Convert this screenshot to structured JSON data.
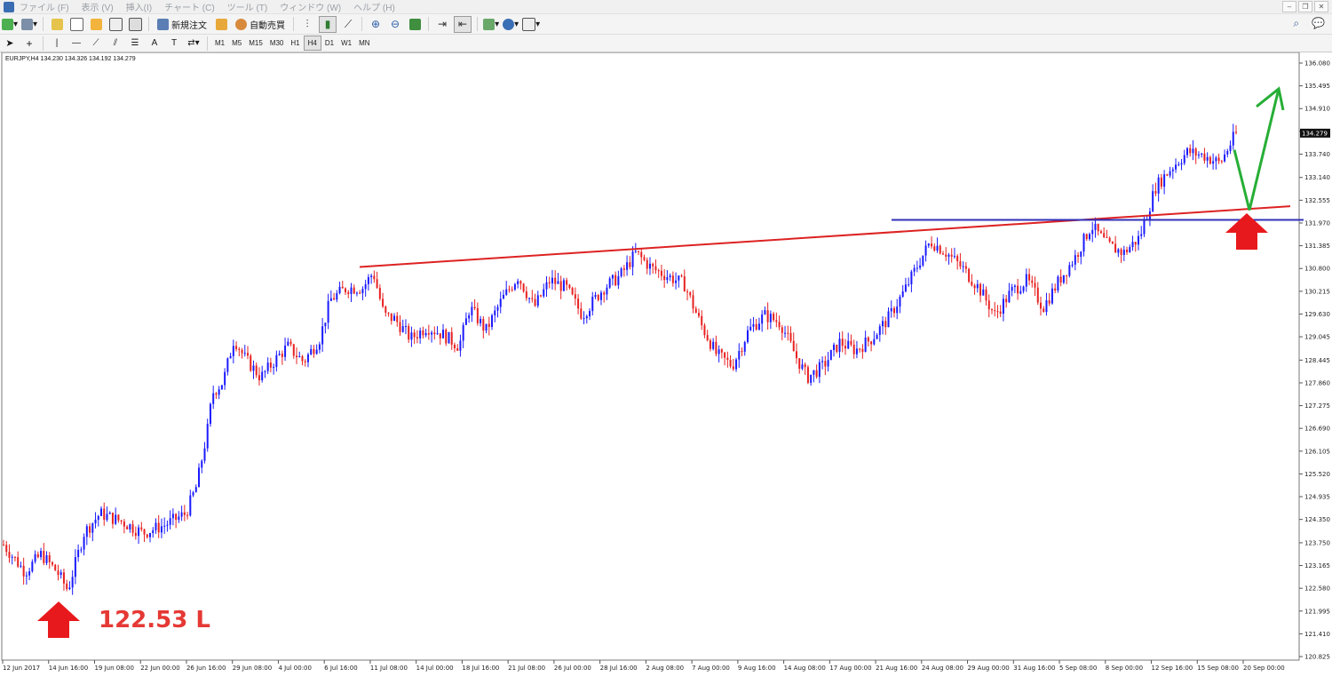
{
  "menu": [
    "ファイル (F)",
    "表示 (V)",
    "挿入(I)",
    "チャート (C)",
    "ツール (T)",
    "ウィンドウ (W)",
    "ヘルプ (H)"
  ],
  "toolbar": {
    "new_order_label": "新規注文",
    "auto_trade_label": "自動売買"
  },
  "timeframes": [
    "M1",
    "M5",
    "M15",
    "M30",
    "H1",
    "H4",
    "D1",
    "W1",
    "MN"
  ],
  "active_timeframe": "H4",
  "chart": {
    "title": "EURJPY,H4  134.230 134.326 134.192 134.279",
    "current_price": "134.279",
    "low_annotation": "122.53 L",
    "colors": {
      "bull": "#1a1aff",
      "bear": "#e82020",
      "trendline": "#dd2222",
      "horizontal_line": "#3030b8",
      "forecast_arrow": "#27ae36",
      "support_arrow": "#e8191d"
    }
  },
  "chart_data": {
    "type": "candlestick",
    "symbol": "EURJPY",
    "timeframe": "H4",
    "ylim": [
      120.825,
      136.08
    ],
    "y_ticks": [
      "136.080",
      "135.495",
      "134.910",
      "134.325",
      "133.740",
      "133.140",
      "132.555",
      "131.970",
      "131.385",
      "130.800",
      "130.215",
      "129.630",
      "129.045",
      "128.445",
      "127.860",
      "127.275",
      "126.690",
      "126.105",
      "125.520",
      "124.935",
      "124.350",
      "123.750",
      "123.165",
      "122.580",
      "121.995",
      "121.410",
      "120.825"
    ],
    "x_ticks": [
      "12 Jun 2017",
      "14 Jun 16:00",
      "19 Jun 08:00",
      "22 Jun 00:00",
      "26 Jun 16:00",
      "29 Jun 08:00",
      "4 Jul 00:00",
      "6 Jul 16:00",
      "11 Jul 08:00",
      "14 Jul 00:00",
      "18 Jul 16:00",
      "21 Jul 08:00",
      "26 Jul 00:00",
      "28 Jul 16:00",
      "2 Aug 08:00",
      "7 Aug 00:00",
      "9 Aug 16:00",
      "14 Aug 08:00",
      "17 Aug 00:00",
      "21 Aug 16:00",
      "24 Aug 08:00",
      "29 Aug 00:00",
      "31 Aug 16:00",
      "5 Sep 08:00",
      "8 Sep 00:00",
      "12 Sep 16:00",
      "15 Sep 08:00",
      "20 Sep 00:00"
    ],
    "price_path": [
      [
        0,
        123.7
      ],
      [
        0.04,
        123.0
      ],
      [
        0.07,
        123.45
      ],
      [
        0.1,
        123.0
      ],
      [
        0.12,
        122.53
      ],
      [
        0.15,
        124.0
      ],
      [
        0.18,
        124.5
      ],
      [
        0.22,
        124.3
      ],
      [
        0.26,
        124.0
      ],
      [
        0.3,
        124.2
      ],
      [
        0.34,
        124.5
      ],
      [
        0.36,
        125.2
      ],
      [
        0.38,
        126.6
      ],
      [
        0.39,
        127.6
      ],
      [
        0.41,
        127.9
      ],
      [
        0.43,
        129.0
      ],
      [
        0.45,
        128.5
      ],
      [
        0.48,
        128.0
      ],
      [
        0.51,
        128.5
      ],
      [
        0.53,
        128.8
      ],
      [
        0.56,
        128.4
      ],
      [
        0.59,
        129.0
      ],
      [
        0.61,
        130.0
      ],
      [
        0.64,
        130.3
      ],
      [
        0.67,
        130.3
      ],
      [
        0.69,
        130.7
      ],
      [
        0.71,
        129.6
      ],
      [
        0.73,
        129.5
      ],
      [
        0.76,
        129.0
      ],
      [
        0.79,
        129.3
      ],
      [
        0.82,
        129.1
      ],
      [
        0.85,
        128.8
      ],
      [
        0.87,
        129.8
      ],
      [
        0.9,
        129.2
      ],
      [
        0.93,
        130.0
      ],
      [
        0.96,
        130.6
      ],
      [
        0.99,
        129.8
      ],
      [
        1.02,
        130.5
      ],
      [
        1.05,
        130.3
      ],
      [
        1.08,
        129.6
      ],
      [
        1.12,
        130.3
      ],
      [
        1.15,
        130.6
      ],
      [
        1.18,
        131.2
      ],
      [
        1.21,
        130.8
      ],
      [
        1.24,
        130.6
      ],
      [
        1.27,
        130.4
      ],
      [
        1.3,
        129.4
      ],
      [
        1.33,
        128.6
      ],
      [
        1.36,
        128.3
      ],
      [
        1.39,
        129.2
      ],
      [
        1.42,
        129.6
      ],
      [
        1.45,
        129.4
      ],
      [
        1.48,
        128.5
      ],
      [
        1.5,
        128.0
      ],
      [
        1.53,
        128.3
      ],
      [
        1.56,
        128.9
      ],
      [
        1.59,
        128.7
      ],
      [
        1.62,
        129.0
      ],
      [
        1.65,
        129.5
      ],
      [
        1.68,
        130.2
      ],
      [
        1.71,
        131.0
      ],
      [
        1.73,
        131.5
      ],
      [
        1.76,
        131.2
      ],
      [
        1.79,
        130.8
      ],
      [
        1.82,
        130.3
      ],
      [
        1.85,
        129.6
      ],
      [
        1.88,
        130.2
      ],
      [
        1.91,
        130.5
      ],
      [
        1.94,
        129.8
      ],
      [
        1.97,
        130.5
      ],
      [
        2.0,
        131.1
      ],
      [
        2.03,
        131.9
      ],
      [
        2.06,
        131.4
      ],
      [
        2.09,
        131.2
      ],
      [
        2.12,
        131.6
      ],
      [
        2.15,
        132.9
      ],
      [
        2.18,
        133.4
      ],
      [
        2.21,
        133.8
      ],
      [
        2.24,
        133.7
      ],
      [
        2.27,
        133.5
      ],
      [
        2.3,
        134.28
      ]
    ]
  }
}
